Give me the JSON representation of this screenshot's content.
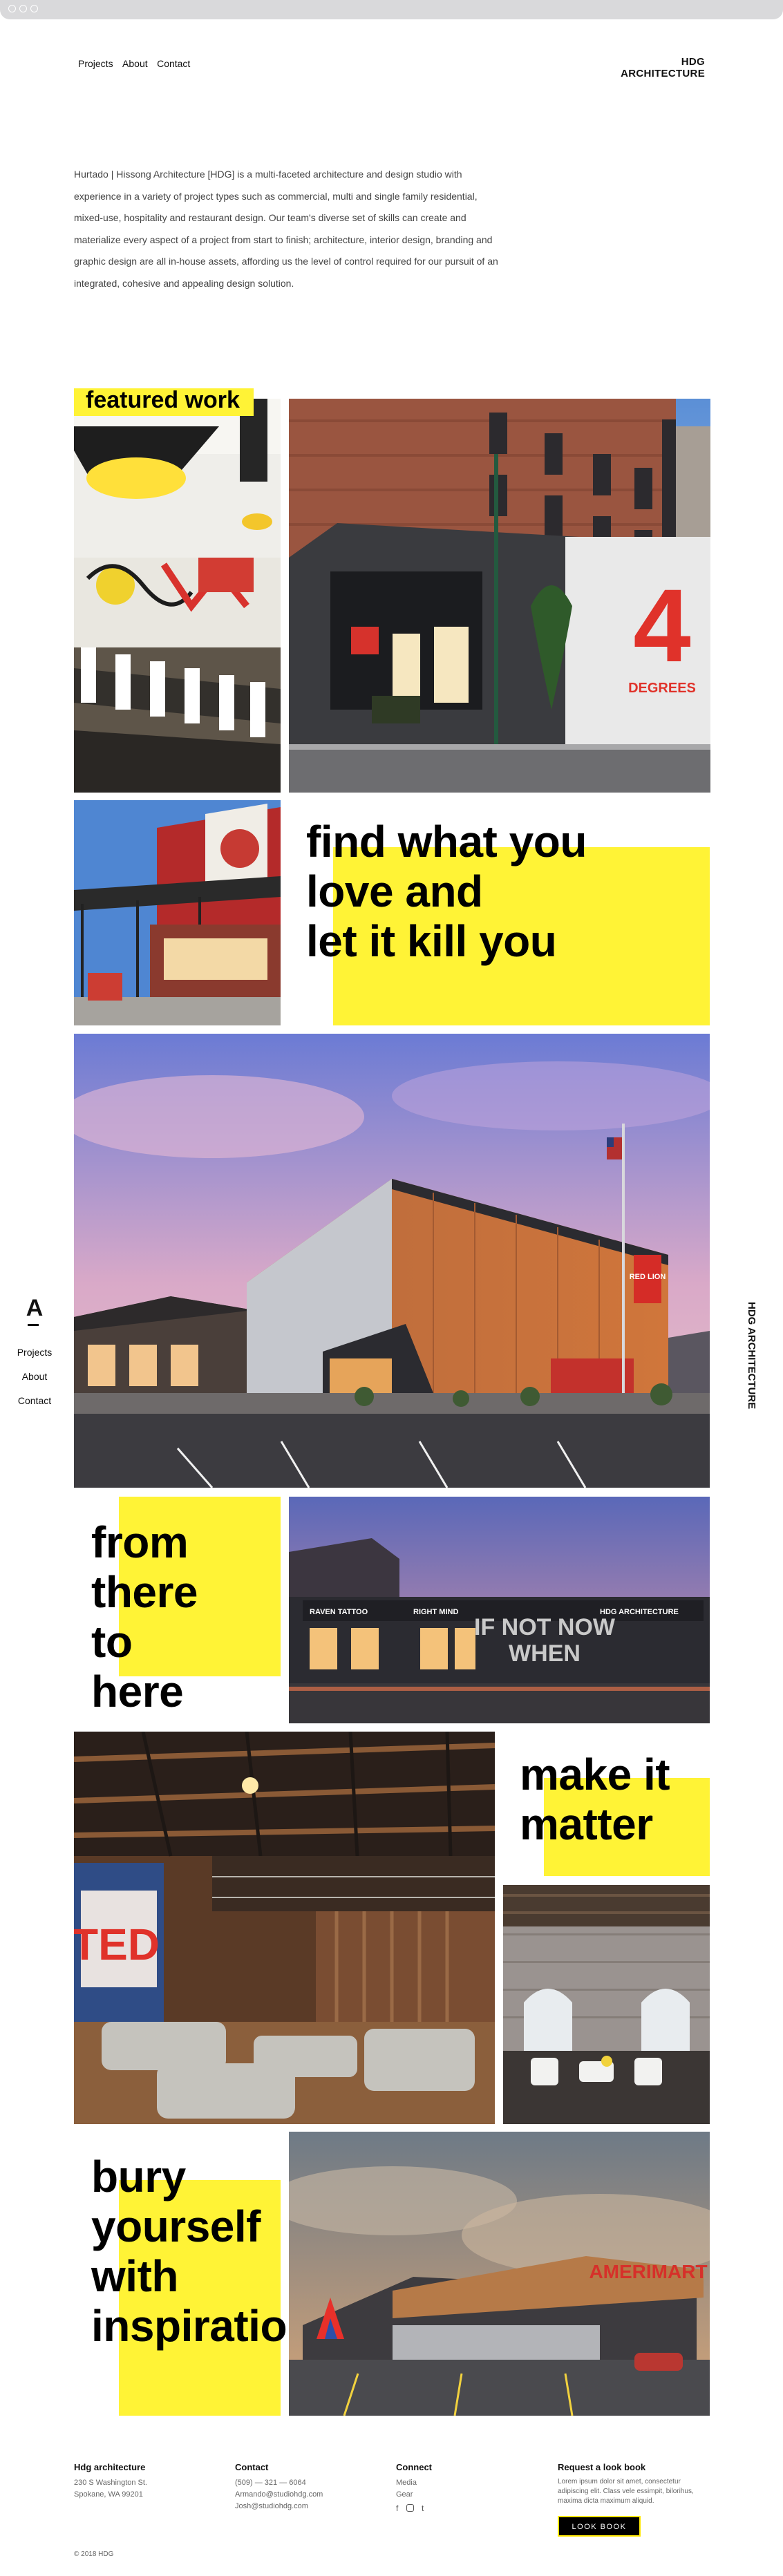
{
  "header": {
    "nav": [
      "Projects",
      "About",
      "Contact"
    ],
    "brand": "HDG ARCHITECTURE"
  },
  "intro": {
    "text": "Hurtado | Hissong Architecture [HDG] is a multi-faceted architecture and design studio with experience in a variety of project types such as commercial, multi and single family residential, mixed-use, hospitality and restaurant design. Our team's diverse set of skills can create and materialize every aspect of a project from start to finish; architecture, interior design, branding and graphic design are all in-house assets, affording us the level of control required for our pursuit of an integrated, cohesive and appealing design solution."
  },
  "featured_label": "featured work",
  "quotes": {
    "q1": [
      "find what you",
      "love and",
      "let it kill you"
    ],
    "q2": [
      "from",
      "there",
      "to",
      "here"
    ],
    "q3": [
      "make it",
      "matter"
    ],
    "q4": [
      "bury",
      "yourself",
      "with",
      "inspiratio"
    ]
  },
  "photo_signs": {
    "four_degrees_number": "4",
    "four_degrees_word": "DEGREES",
    "red_lion": "RED LION",
    "ifnotnow_1": "IF NOT NOW",
    "ifnotnow_2": "WHEN",
    "raven": "RAVEN TATTOO",
    "right_mind": "RIGHT MIND",
    "hdg": "HDG ARCHITECTURE",
    "ted": "TED",
    "amerimart": "AMERIMART"
  },
  "sidebar": {
    "logo": "A",
    "links": [
      "Projects",
      "About",
      "Contact"
    ],
    "vertical_brand": "HDG ARCHITECTURE"
  },
  "footer": {
    "col1": {
      "heading": "Hdg architecture",
      "lines": [
        "230 S Washington St.",
        "Spokane, WA 99201"
      ]
    },
    "col2": {
      "heading": "Contact",
      "lines": [
        "(509) — 321 — 6064",
        "Armando@studiohdg.com",
        "Josh@studiohdg.com"
      ]
    },
    "col3": {
      "heading": "Connect",
      "lines": [
        "Media",
        "Gear"
      ],
      "icons": [
        "facebook-icon",
        "instagram-icon",
        "tumblr-icon"
      ]
    },
    "col4": {
      "heading": "Request a look book",
      "lines": [
        "Lorem ipsum dolor sit amet, consectetur",
        "adipiscing elit. Class vele essimpit, bilorihus,",
        "maxima dicta maximum aliquid."
      ],
      "button": "LOOK BOOK"
    },
    "copyright": "© 2018 HDG"
  },
  "colors": {
    "accent": "#fff336",
    "text": "#111111",
    "background": "#ffffff"
  }
}
